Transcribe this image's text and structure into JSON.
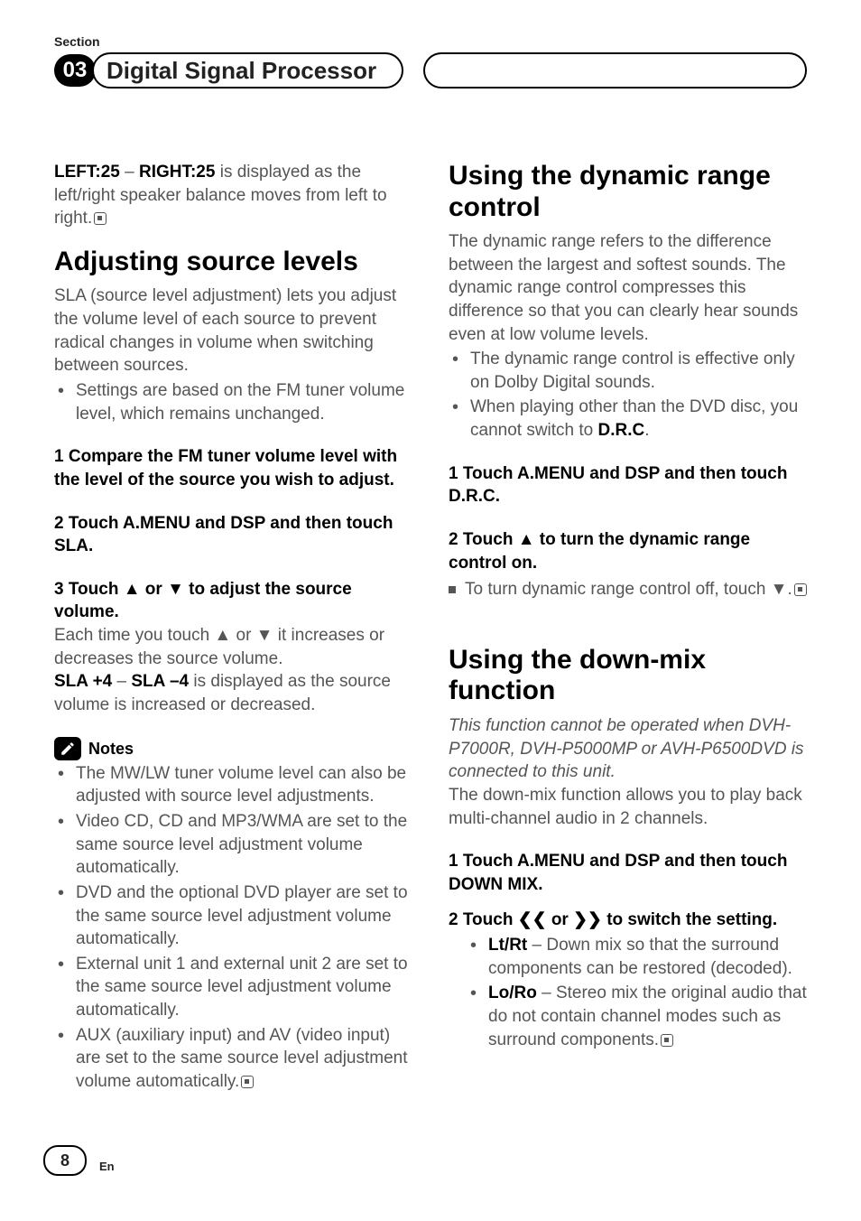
{
  "header": {
    "section_label": "Section",
    "section_number": "03",
    "title": "Digital Signal Processor"
  },
  "left_col": {
    "balance_line": {
      "leftLabel": "LEFT:25",
      "dash": " – ",
      "rightLabel": "RIGHT:25",
      "rest": " is displayed as the left/right speaker balance moves from left to right."
    },
    "h2_adjust": "Adjusting source levels",
    "sla_para": "SLA (source level adjustment) lets you adjust the volume level of each source to prevent radical changes in volume when switching between sources.",
    "sla_bullets": [
      "Settings are based on the FM tuner volume level, which remains unchanged."
    ],
    "step1": "1    Compare the FM tuner volume level with the level of the source you wish to adjust.",
    "step2": "2    Touch A.MENU and DSP and then touch SLA.",
    "step3": "3    Touch ▲ or ▼ to adjust the source volume.",
    "step3_detail": "Each time you touch ▲ or ▼ it increases or decreases the source volume.",
    "step3_range": {
      "a": "SLA +4",
      "dash": " – ",
      "b": "SLA –4",
      "rest": " is displayed as the source volume is increased or decreased."
    },
    "notes_label": "Notes",
    "notes": [
      "The MW/LW tuner volume level can also be adjusted with source level adjustments.",
      "Video CD, CD and MP3/WMA are set to the same source level adjustment volume automatically.",
      "DVD and the optional DVD player are set to the same source level adjustment volume automatically.",
      "External unit 1 and external unit 2 are set to the same source level adjustment volume automatically.",
      "AUX (auxiliary input) and AV (video input) are set to the same source level adjustment volume automatically."
    ]
  },
  "right_col": {
    "h2_drc": "Using the dynamic range control",
    "drc_para": "The dynamic range refers to the difference between the largest and softest sounds. The dynamic range control compresses this difference so that you can clearly hear sounds even at low volume levels.",
    "drc_bullets": [
      "The dynamic range control is effective only on Dolby Digital sounds.",
      "When playing other than the DVD disc, you cannot switch to "
    ],
    "drc_label": "D.R.C",
    "drc_step1": "1    Touch A.MENU and DSP and then touch D.R.C.",
    "drc_step2": "2    Touch ▲ to turn the dynamic range control on.",
    "drc_off": "To turn dynamic range control off, touch ▼.",
    "h2_dm": "Using the down-mix function",
    "dm_italic": "This function cannot be operated when DVH-P7000R, DVH-P5000MP or AVH-P6500DVD is connected to this unit.",
    "dm_para": "The down-mix function allows you to play back multi-channel audio in 2 channels.",
    "dm_step1": "1    Touch A.MENU and DSP and then touch DOWN MIX.",
    "dm_step2": "2    Touch ❮❮ or ❯❯ to switch the setting.",
    "dm_opts": [
      {
        "label": "Lt/Rt",
        "rest": " – Down mix so that the surround components can be restored (decoded)."
      },
      {
        "label": "Lo/Ro",
        "rest": " – Stereo mix the original audio that do not contain channel modes such as surround components."
      }
    ]
  },
  "footer": {
    "page": "8",
    "lang": "En"
  }
}
